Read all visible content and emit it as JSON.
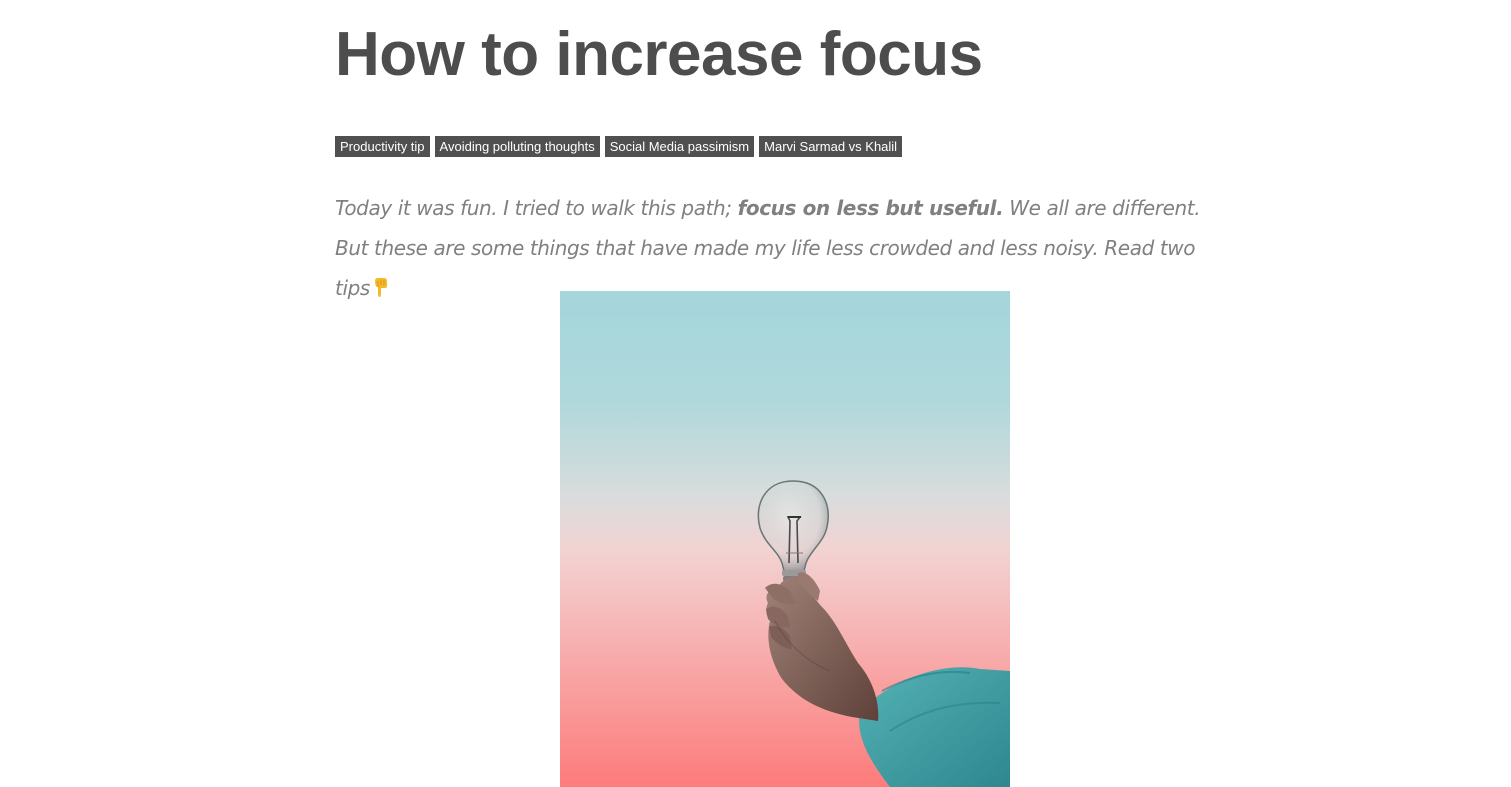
{
  "article": {
    "title": "How to increase focus",
    "tags": [
      "Productivity tip",
      "Avoiding polluting thoughts",
      "Social Media passimism",
      "Marvi Sarmad vs Khalil"
    ],
    "intro": {
      "part1": "Today it was fun. I tried to walk this path; ",
      "bold": "focus on less but useful.",
      "part2": " We all are different. But these are some things that have made my life less crowded and less noisy. Read two tips",
      "end_icon": "point-down-icon"
    },
    "hero_image": {
      "subject": "hand-holding-lightbulb",
      "colors": {
        "sky_top": "#a4d6dc",
        "sky_mid": "#f2d3d2",
        "sky_bottom": "#fd7b7b",
        "sleeve": "#3a9ea3",
        "skin": "#7a5c52"
      }
    }
  }
}
